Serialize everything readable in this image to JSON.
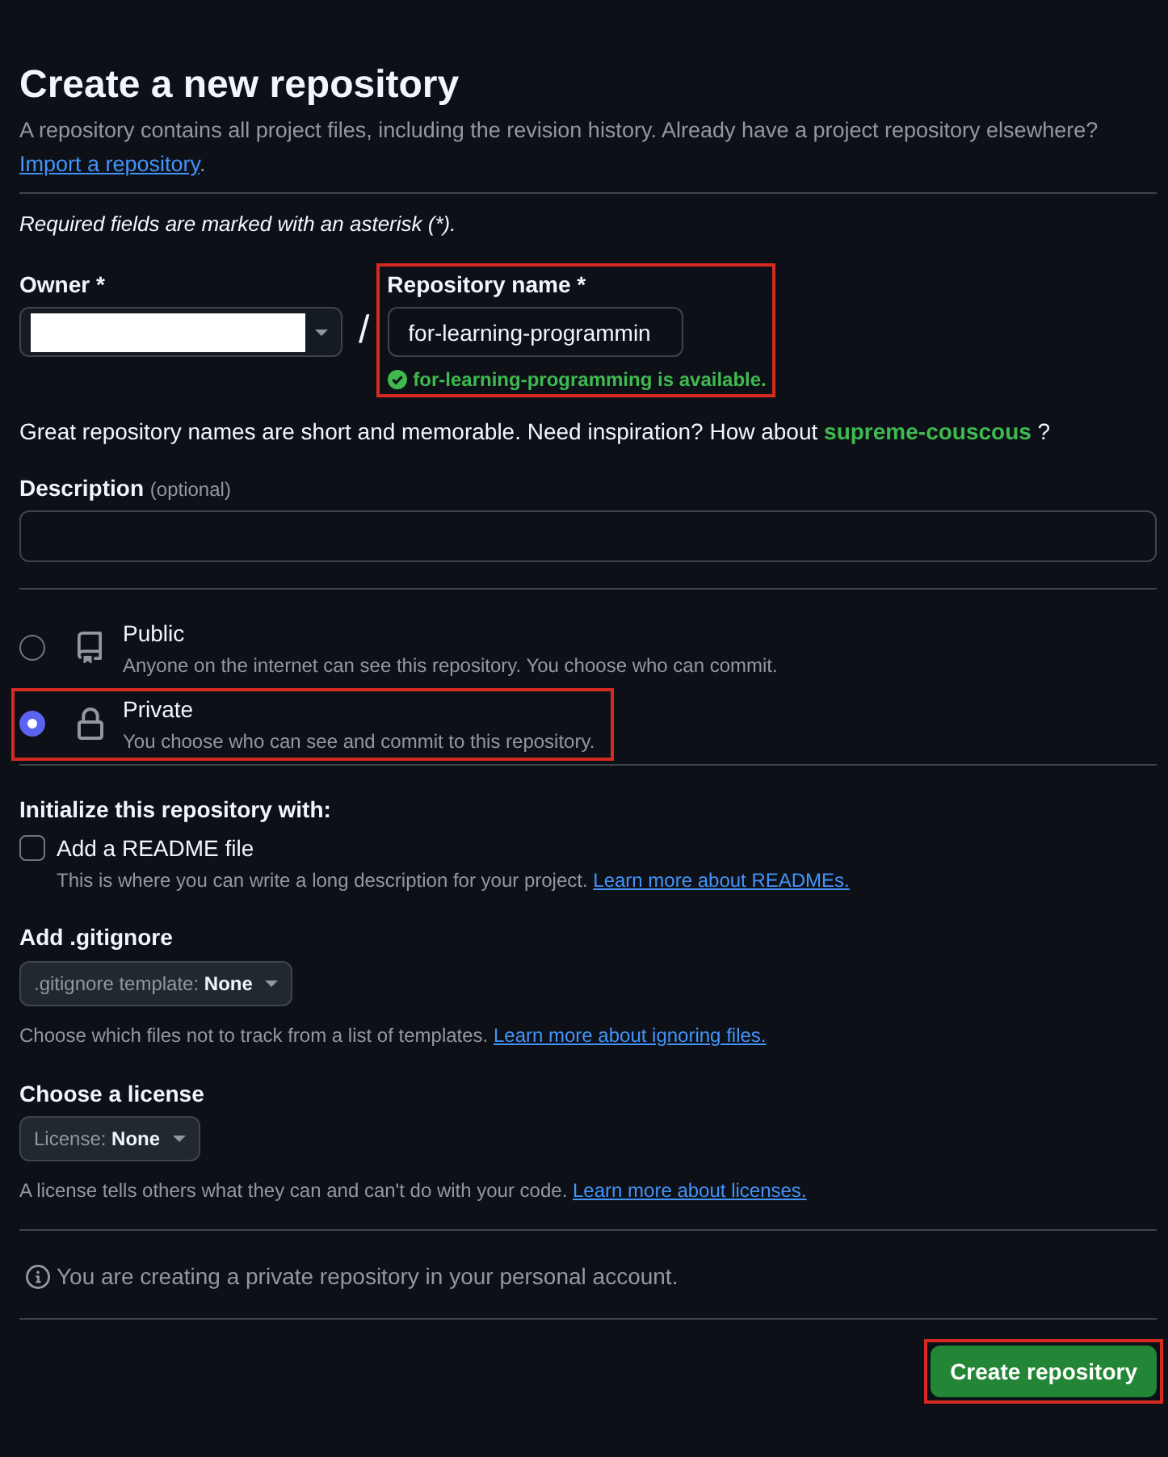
{
  "header": {
    "title": "Create a new repository",
    "subtitle": "A repository contains all project files, including the revision history. Already have a project repository elsewhere?",
    "link": "Import a repository",
    "link_suffix": "."
  },
  "required_note": "Required fields are marked with an asterisk (*).",
  "owner": {
    "label": "Owner *",
    "redacted": true
  },
  "separator": "/",
  "repo_name": {
    "label": "Repository name *",
    "value": "for-learning-programmin",
    "availability": "for-learning-programming is available.",
    "highlighted": true
  },
  "name_hint": {
    "text": "Great repository names are short and memorable. Need inspiration? How about",
    "suggestion": "supreme-couscous",
    "suffix": "?"
  },
  "description": {
    "label": "Description",
    "note": "(optional)"
  },
  "visibility": [
    {
      "kind": "public",
      "label": "Public",
      "description": "Anyone on the internet can see this repository. You choose who can commit.",
      "selected": false,
      "highlighted": false
    },
    {
      "kind": "private",
      "label": "Private",
      "description": "You choose who can see and commit to this repository.",
      "selected": true,
      "highlighted": true
    }
  ],
  "initialize": {
    "heading": "Initialize this repository with:",
    "readme": {
      "label": "Add a README file",
      "checked": false,
      "description": "This is where you can write a long description for your project.",
      "link": "Learn more about READMEs."
    }
  },
  "gitignore": {
    "heading": "Add .gitignore",
    "select_prefix": ".gitignore template:",
    "select_value": "None",
    "help": "Choose which files not to track from a list of templates.",
    "link": "Learn more about ignoring files."
  },
  "license": {
    "heading": "Choose a license",
    "select_prefix": "License:",
    "select_value": "None",
    "help": "A license tells others what they can and can't do with your code.",
    "link": "Learn more about licenses."
  },
  "notice": "You are creating a private repository in your personal account.",
  "submit": {
    "label": "Create repository",
    "highlighted": true
  }
}
